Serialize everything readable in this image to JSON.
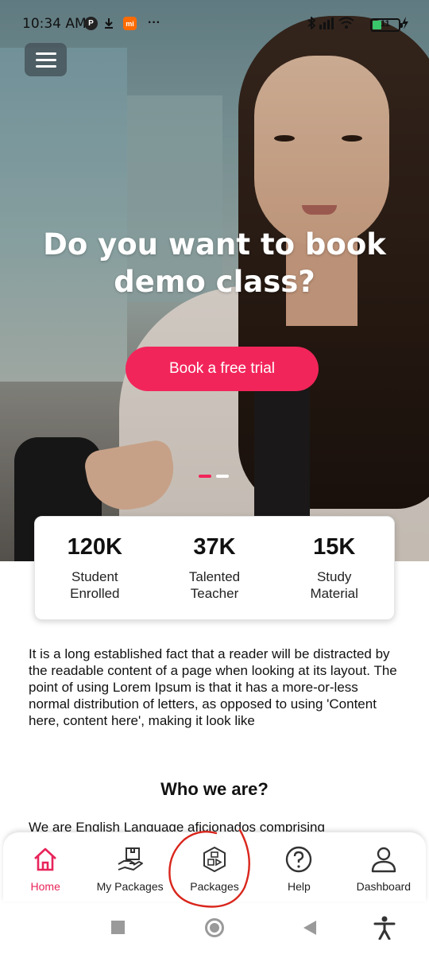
{
  "status_bar": {
    "time": "10:34 AM",
    "battery_level": "11",
    "icons": [
      "app-badge-icon",
      "download-icon",
      "mi-icon",
      "more-dots-icon",
      "bluetooth-icon",
      "signal-icon",
      "wifi-icon",
      "battery-icon",
      "charging-icon"
    ],
    "mi_label": "mi",
    "more_label": "···"
  },
  "hero": {
    "title": "Do you want to book demo class?",
    "cta_label": "Book a free trial",
    "slides_total": 2,
    "slide_active": 1
  },
  "stats": [
    {
      "value": "120K",
      "line1": "Student",
      "line2": "Enrolled"
    },
    {
      "value": "37K",
      "line1": "Talented",
      "line2": "Teacher"
    },
    {
      "value": "15K",
      "line1": "Study",
      "line2": "Material"
    }
  ],
  "intro_text": "It is a long established fact that a reader will be distracted by the readable content of a page when looking at its layout. The point of using Lorem Ipsum is that it has a more-or-less normal distribution of letters, as opposed to using 'Content here, content here', making it look like",
  "about": {
    "title": "Who we are?",
    "text_partial": "We are English Language aficionados comprising"
  },
  "bottom_nav": [
    {
      "label": "Home",
      "icon": "home-icon",
      "active": true
    },
    {
      "label": "My Packages",
      "icon": "my-packages-icon",
      "active": false
    },
    {
      "label": "Packages",
      "icon": "packages-icon",
      "active": false
    },
    {
      "label": "Help",
      "icon": "help-icon",
      "active": false
    },
    {
      "label": "Dashboard",
      "icon": "dashboard-icon",
      "active": false
    }
  ],
  "colors": {
    "accent": "#f2255a",
    "active_nav": "#e8245a",
    "annotation": "#d9261c"
  }
}
